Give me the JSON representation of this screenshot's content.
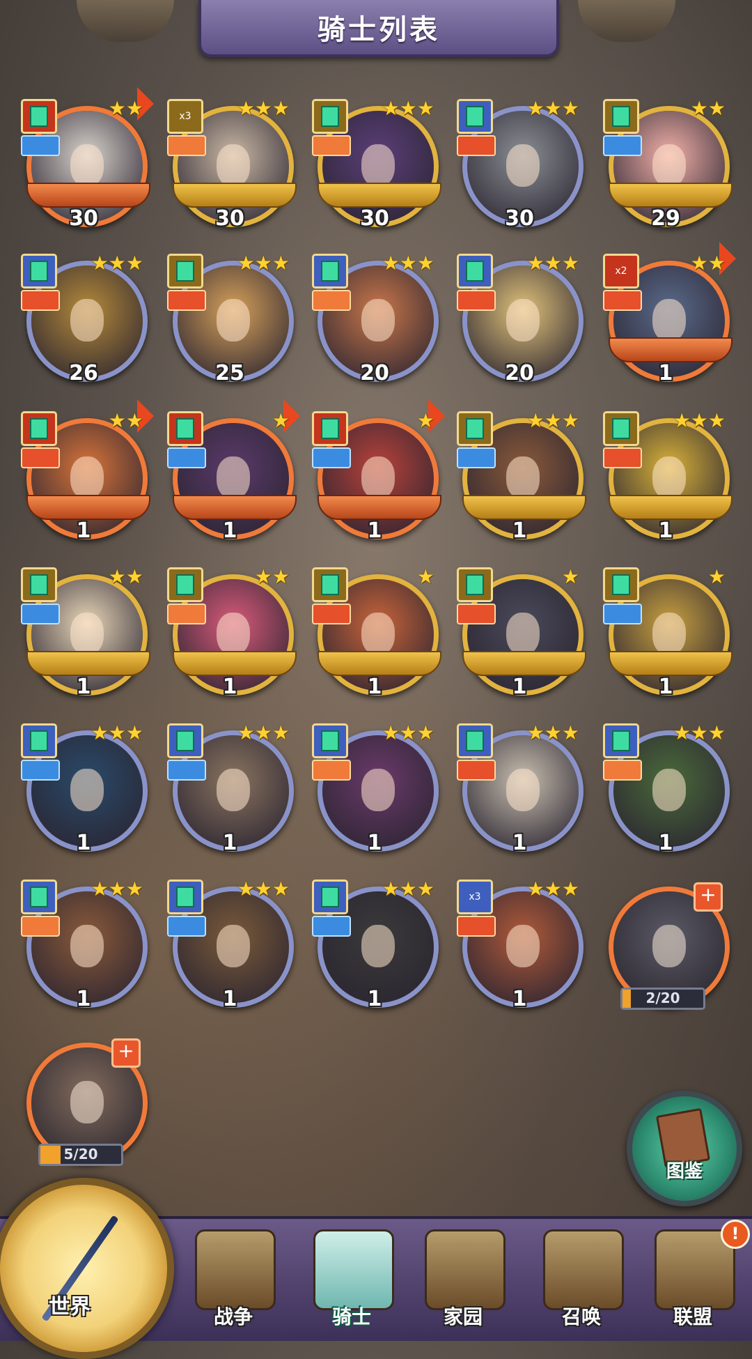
{
  "title": "骑士列表",
  "heroes": [
    {
      "level": "30",
      "stars": "★★",
      "frame": "orange",
      "badge": "red",
      "role": "blue",
      "arrow": true,
      "face": "#d8d2cc"
    },
    {
      "level": "30",
      "stars": "★★★",
      "frame": "gold",
      "badge": "gold",
      "role": "orange",
      "arrow": false,
      "face": "#c9b8a4",
      "mult": "x3"
    },
    {
      "level": "30",
      "stars": "★★★",
      "frame": "gold",
      "badge": "gold",
      "role": "orange",
      "arrow": false,
      "face": "#5b3f7a"
    },
    {
      "level": "30",
      "stars": "★★★",
      "frame": "blue",
      "badge": "blue",
      "role": "red",
      "arrow": false,
      "face": "#8a8f94"
    },
    {
      "level": "29",
      "stars": "★★",
      "frame": "gold",
      "badge": "gold",
      "role": "blue",
      "arrow": false,
      "face": "#f2b0a8"
    },
    {
      "level": "26",
      "stars": "★★★",
      "frame": "blue",
      "badge": "blue",
      "role": "red",
      "arrow": false,
      "face": "#b58a3a"
    },
    {
      "level": "25",
      "stars": "★★★",
      "frame": "blue",
      "badge": "gold",
      "role": "red",
      "arrow": false,
      "face": "#d6a05a"
    },
    {
      "level": "20",
      "stars": "★★★",
      "frame": "blue",
      "badge": "blue",
      "role": "orange",
      "arrow": false,
      "face": "#c9774a"
    },
    {
      "level": "20",
      "stars": "★★★",
      "frame": "blue",
      "badge": "blue",
      "role": "red",
      "arrow": false,
      "face": "#e0c27a"
    },
    {
      "level": "1",
      "stars": "★★",
      "frame": "orange",
      "badge": "red",
      "role": "red",
      "arrow": true,
      "face": "#5a6a8a",
      "mult": "x2"
    },
    {
      "level": "1",
      "stars": "★★",
      "frame": "orange",
      "badge": "red",
      "role": "red",
      "arrow": true,
      "face": "#d8743a"
    },
    {
      "level": "1",
      "stars": "★",
      "frame": "orange",
      "badge": "red",
      "role": "blue",
      "arrow": true,
      "face": "#5a3a6a"
    },
    {
      "level": "1",
      "stars": "★",
      "frame": "orange",
      "badge": "red",
      "role": "blue",
      "arrow": true,
      "face": "#b8423a"
    },
    {
      "level": "1",
      "stars": "★★★",
      "frame": "gold",
      "badge": "gold",
      "role": "blue",
      "arrow": false,
      "face": "#8a5a3a"
    },
    {
      "level": "1",
      "stars": "★★★",
      "frame": "gold",
      "badge": "gold",
      "role": "red",
      "arrow": false,
      "face": "#d8b23a"
    },
    {
      "level": "1",
      "stars": "★★",
      "frame": "gold",
      "badge": "gold",
      "role": "blue",
      "arrow": false,
      "face": "#e8d6b8"
    },
    {
      "level": "1",
      "stars": "★★",
      "frame": "gold",
      "badge": "gold",
      "role": "orange",
      "arrow": false,
      "face": "#d85a7a"
    },
    {
      "level": "1",
      "stars": "★",
      "frame": "gold",
      "badge": "gold",
      "role": "red",
      "arrow": false,
      "face": "#c8643a"
    },
    {
      "level": "1",
      "stars": "★",
      "frame": "gold",
      "badge": "gold",
      "role": "red",
      "arrow": false,
      "face": "#4a4a5a"
    },
    {
      "level": "1",
      "stars": "★",
      "frame": "gold",
      "badge": "gold",
      "role": "blue",
      "arrow": false,
      "face": "#c8a040"
    },
    {
      "level": "1",
      "stars": "★★★",
      "frame": "blue",
      "badge": "blue",
      "role": "blue",
      "arrow": false,
      "face": "#2a4a6a"
    },
    {
      "level": "1",
      "stars": "★★★",
      "frame": "blue",
      "badge": "blue",
      "role": "blue",
      "arrow": false,
      "face": "#8a7460"
    },
    {
      "level": "1",
      "stars": "★★★",
      "frame": "blue",
      "badge": "blue",
      "role": "orange",
      "arrow": false,
      "face": "#6a3a6a"
    },
    {
      "level": "1",
      "stars": "★★★",
      "frame": "blue",
      "badge": "blue",
      "role": "red",
      "arrow": false,
      "face": "#c8c0b0"
    },
    {
      "level": "1",
      "stars": "★★★",
      "frame": "blue",
      "badge": "blue",
      "role": "orange",
      "arrow": false,
      "face": "#4a6a3a"
    },
    {
      "level": "1",
      "stars": "★★★",
      "frame": "blue",
      "badge": "blue",
      "role": "orange",
      "arrow": false,
      "face": "#8a5a3a"
    },
    {
      "level": "1",
      "stars": "★★★",
      "frame": "blue",
      "badge": "blue",
      "role": "blue",
      "arrow": false,
      "face": "#7a5a3a"
    },
    {
      "level": "1",
      "stars": "★★★",
      "frame": "blue",
      "badge": "blue",
      "role": "blue",
      "arrow": false,
      "face": "#3a3a3a"
    },
    {
      "level": "1",
      "stars": "★★★",
      "frame": "blue",
      "badge": "blue",
      "role": "red",
      "arrow": false,
      "face": "#b05a3a",
      "mult": "x3"
    }
  ],
  "fragments": [
    {
      "text": "2/20",
      "progress": 0.1,
      "face": "#5a5a6a"
    },
    {
      "text": "5/20",
      "progress": 0.25,
      "face": "#8a6a54"
    }
  ],
  "codex_label": "图鉴",
  "nav": {
    "world": "世界",
    "items": [
      {
        "label": "战争",
        "active": false
      },
      {
        "label": "骑士",
        "active": true
      },
      {
        "label": "家园",
        "active": false
      },
      {
        "label": "召唤",
        "active": false
      },
      {
        "label": "联盟",
        "active": false
      }
    ],
    "alert": "!"
  }
}
